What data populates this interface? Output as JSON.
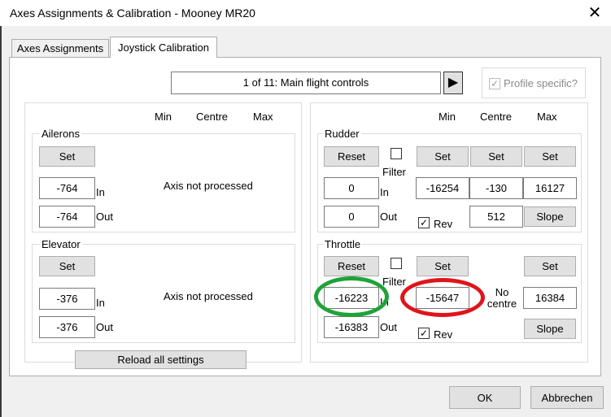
{
  "window": {
    "title": "Axes Assignments & Calibration - Mooney MR20",
    "close_glyph": "✕"
  },
  "tabs": [
    {
      "label": "Axes Assignments",
      "active": false
    },
    {
      "label": "Joystick Calibration",
      "active": true
    }
  ],
  "profile": {
    "selector_text": "1 of 11: Main flight controls",
    "next_glyph": "▶",
    "specific_label": "Profile specific?",
    "specific_checked": true
  },
  "headers": {
    "min": "Min",
    "centre": "Centre",
    "max": "Max"
  },
  "ailerons": {
    "label": "Ailerons",
    "set": "Set",
    "in_value": "-764",
    "in_label": "In",
    "out_value": "-764",
    "out_label": "Out",
    "status": "Axis not processed"
  },
  "elevator": {
    "label": "Elevator",
    "set": "Set",
    "in_value": "-376",
    "in_label": "In",
    "out_value": "-376",
    "out_label": "Out",
    "status": "Axis not processed"
  },
  "reload_label": "Reload all settings",
  "rudder": {
    "label": "Rudder",
    "reset": "Reset",
    "filter": "Filter",
    "set_min": "Set",
    "set_centre": "Set",
    "set_max": "Set",
    "in_value": "0",
    "in_label": "In",
    "out_value": "0",
    "out_label": "Out",
    "min_value": "-16254",
    "centre_value": "-130",
    "max_value": "16127",
    "rev_label": "Rev",
    "rev_checked": true,
    "slope_value": "512",
    "slope_label": "Slope"
  },
  "throttle": {
    "label": "Throttle",
    "reset": "Reset",
    "filter": "Filter",
    "set_min": "Set",
    "set_max": "Set",
    "in_value": "-16223",
    "in_label": "In",
    "out_value": "-16383",
    "out_label": "Out",
    "min_value": "-15647",
    "no_centre_label": "No centre",
    "max_value": "16384",
    "rev_label": "Rev",
    "rev_checked": true,
    "slope_label": "Slope"
  },
  "footer": {
    "ok": "OK",
    "cancel": "Abbrechen"
  },
  "colors": {
    "green_marker": "#1fa339",
    "red_marker": "#e0141b"
  }
}
